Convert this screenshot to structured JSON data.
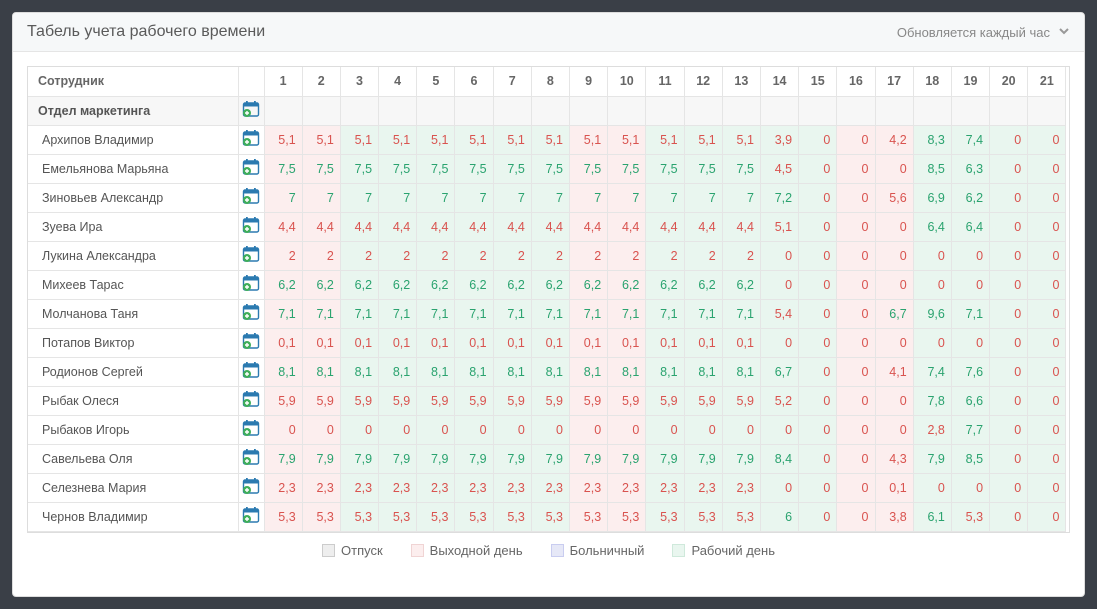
{
  "panel": {
    "title": "Табель учета рабочего времени",
    "refresh": "Обновляется каждый час"
  },
  "columns": {
    "employee": "Сотрудник"
  },
  "days": [
    1,
    2,
    3,
    4,
    5,
    6,
    7,
    8,
    9,
    10,
    11,
    12,
    13,
    14,
    15,
    16,
    17,
    18,
    19,
    20,
    21
  ],
  "day_types": [
    "w",
    "w",
    "g",
    "g",
    "g",
    "g",
    "g",
    "g",
    "w",
    "w",
    "g",
    "g",
    "g",
    "g",
    "g",
    "w",
    "w",
    "g",
    "g",
    "g",
    "g"
  ],
  "department": {
    "name": "Отдел маркетинга"
  },
  "employees": [
    {
      "name": "Архипов Владимир",
      "v": [
        "5,1",
        "5,1",
        "5,1",
        "5,1",
        "5,1",
        "5,1",
        "5,1",
        "5,1",
        "5,1",
        "5,1",
        "5,1",
        "5,1",
        "5,1",
        "3,9",
        "0",
        "0",
        "4,2",
        "8,3",
        "7,4",
        "0",
        "0"
      ],
      "c": [
        "r",
        "r",
        "r",
        "r",
        "r",
        "r",
        "r",
        "r",
        "r",
        "r",
        "r",
        "r",
        "r",
        "r",
        "r",
        "r",
        "r",
        "g",
        "g",
        "r",
        "r"
      ]
    },
    {
      "name": "Емельянова Марьяна",
      "v": [
        "7,5",
        "7,5",
        "7,5",
        "7,5",
        "7,5",
        "7,5",
        "7,5",
        "7,5",
        "7,5",
        "7,5",
        "7,5",
        "7,5",
        "7,5",
        "4,5",
        "0",
        "0",
        "0",
        "8,5",
        "6,3",
        "0",
        "0"
      ],
      "c": [
        "g",
        "g",
        "g",
        "g",
        "g",
        "g",
        "g",
        "g",
        "g",
        "g",
        "g",
        "g",
        "g",
        "r",
        "r",
        "r",
        "r",
        "g",
        "g",
        "r",
        "r"
      ]
    },
    {
      "name": "Зиновьев Александр",
      "v": [
        "7",
        "7",
        "7",
        "7",
        "7",
        "7",
        "7",
        "7",
        "7",
        "7",
        "7",
        "7",
        "7",
        "7,2",
        "0",
        "0",
        "5,6",
        "6,9",
        "6,2",
        "0",
        "0"
      ],
      "c": [
        "g",
        "g",
        "g",
        "g",
        "g",
        "g",
        "g",
        "g",
        "g",
        "g",
        "g",
        "g",
        "g",
        "g",
        "r",
        "r",
        "r",
        "g",
        "g",
        "r",
        "r"
      ]
    },
    {
      "name": "Зуева Ира",
      "v": [
        "4,4",
        "4,4",
        "4,4",
        "4,4",
        "4,4",
        "4,4",
        "4,4",
        "4,4",
        "4,4",
        "4,4",
        "4,4",
        "4,4",
        "4,4",
        "5,1",
        "0",
        "0",
        "0",
        "6,4",
        "6,4",
        "0",
        "0"
      ],
      "c": [
        "r",
        "r",
        "r",
        "r",
        "r",
        "r",
        "r",
        "r",
        "r",
        "r",
        "r",
        "r",
        "r",
        "r",
        "r",
        "r",
        "r",
        "g",
        "g",
        "r",
        "r"
      ]
    },
    {
      "name": "Лукина Александра",
      "v": [
        "2",
        "2",
        "2",
        "2",
        "2",
        "2",
        "2",
        "2",
        "2",
        "2",
        "2",
        "2",
        "2",
        "0",
        "0",
        "0",
        "0",
        "0",
        "0",
        "0",
        "0"
      ],
      "c": [
        "r",
        "r",
        "r",
        "r",
        "r",
        "r",
        "r",
        "r",
        "r",
        "r",
        "r",
        "r",
        "r",
        "r",
        "r",
        "r",
        "r",
        "r",
        "r",
        "r",
        "r"
      ]
    },
    {
      "name": "Михеев Тарас",
      "v": [
        "6,2",
        "6,2",
        "6,2",
        "6,2",
        "6,2",
        "6,2",
        "6,2",
        "6,2",
        "6,2",
        "6,2",
        "6,2",
        "6,2",
        "6,2",
        "0",
        "0",
        "0",
        "0",
        "0",
        "0",
        "0",
        "0"
      ],
      "c": [
        "g",
        "g",
        "g",
        "g",
        "g",
        "g",
        "g",
        "g",
        "g",
        "g",
        "g",
        "g",
        "g",
        "r",
        "r",
        "r",
        "r",
        "r",
        "r",
        "r",
        "r"
      ]
    },
    {
      "name": "Молчанова Таня",
      "v": [
        "7,1",
        "7,1",
        "7,1",
        "7,1",
        "7,1",
        "7,1",
        "7,1",
        "7,1",
        "7,1",
        "7,1",
        "7,1",
        "7,1",
        "7,1",
        "5,4",
        "0",
        "0",
        "6,7",
        "9,6",
        "7,1",
        "0",
        "0"
      ],
      "c": [
        "g",
        "g",
        "g",
        "g",
        "g",
        "g",
        "g",
        "g",
        "g",
        "g",
        "g",
        "g",
        "g",
        "r",
        "r",
        "r",
        "g",
        "g",
        "g",
        "r",
        "r"
      ]
    },
    {
      "name": "Потапов Виктор",
      "v": [
        "0,1",
        "0,1",
        "0,1",
        "0,1",
        "0,1",
        "0,1",
        "0,1",
        "0,1",
        "0,1",
        "0,1",
        "0,1",
        "0,1",
        "0,1",
        "0",
        "0",
        "0",
        "0",
        "0",
        "0",
        "0",
        "0"
      ],
      "c": [
        "r",
        "r",
        "r",
        "r",
        "r",
        "r",
        "r",
        "r",
        "r",
        "r",
        "r",
        "r",
        "r",
        "r",
        "r",
        "r",
        "r",
        "r",
        "r",
        "r",
        "r"
      ]
    },
    {
      "name": "Родионов Сергей",
      "v": [
        "8,1",
        "8,1",
        "8,1",
        "8,1",
        "8,1",
        "8,1",
        "8,1",
        "8,1",
        "8,1",
        "8,1",
        "8,1",
        "8,1",
        "8,1",
        "6,7",
        "0",
        "0",
        "4,1",
        "7,4",
        "7,6",
        "0",
        "0"
      ],
      "c": [
        "g",
        "g",
        "g",
        "g",
        "g",
        "g",
        "g",
        "g",
        "g",
        "g",
        "g",
        "g",
        "g",
        "g",
        "r",
        "r",
        "r",
        "g",
        "g",
        "r",
        "r"
      ]
    },
    {
      "name": "Рыбак Олеся",
      "v": [
        "5,9",
        "5,9",
        "5,9",
        "5,9",
        "5,9",
        "5,9",
        "5,9",
        "5,9",
        "5,9",
        "5,9",
        "5,9",
        "5,9",
        "5,9",
        "5,2",
        "0",
        "0",
        "0",
        "7,8",
        "6,6",
        "0",
        "0"
      ],
      "c": [
        "r",
        "r",
        "r",
        "r",
        "r",
        "r",
        "r",
        "r",
        "r",
        "r",
        "r",
        "r",
        "r",
        "r",
        "r",
        "r",
        "r",
        "g",
        "g",
        "r",
        "r"
      ]
    },
    {
      "name": "Рыбаков Игорь",
      "v": [
        "0",
        "0",
        "0",
        "0",
        "0",
        "0",
        "0",
        "0",
        "0",
        "0",
        "0",
        "0",
        "0",
        "0",
        "0",
        "0",
        "0",
        "2,8",
        "7,7",
        "0",
        "0"
      ],
      "c": [
        "r",
        "r",
        "r",
        "r",
        "r",
        "r",
        "r",
        "r",
        "r",
        "r",
        "r",
        "r",
        "r",
        "r",
        "r",
        "r",
        "r",
        "r",
        "g",
        "r",
        "r"
      ]
    },
    {
      "name": "Савельева Оля",
      "v": [
        "7,9",
        "7,9",
        "7,9",
        "7,9",
        "7,9",
        "7,9",
        "7,9",
        "7,9",
        "7,9",
        "7,9",
        "7,9",
        "7,9",
        "7,9",
        "8,4",
        "0",
        "0",
        "4,3",
        "7,9",
        "8,5",
        "0",
        "0"
      ],
      "c": [
        "g",
        "g",
        "g",
        "g",
        "g",
        "g",
        "g",
        "g",
        "g",
        "g",
        "g",
        "g",
        "g",
        "g",
        "r",
        "r",
        "r",
        "g",
        "g",
        "r",
        "r"
      ]
    },
    {
      "name": "Селезнева Мария",
      "v": [
        "2,3",
        "2,3",
        "2,3",
        "2,3",
        "2,3",
        "2,3",
        "2,3",
        "2,3",
        "2,3",
        "2,3",
        "2,3",
        "2,3",
        "2,3",
        "0",
        "0",
        "0",
        "0,1",
        "0",
        "0",
        "0",
        "0"
      ],
      "c": [
        "r",
        "r",
        "r",
        "r",
        "r",
        "r",
        "r",
        "r",
        "r",
        "r",
        "r",
        "r",
        "r",
        "r",
        "r",
        "r",
        "r",
        "r",
        "r",
        "r",
        "r"
      ]
    },
    {
      "name": "Чернов Владимир",
      "v": [
        "5,3",
        "5,3",
        "5,3",
        "5,3",
        "5,3",
        "5,3",
        "5,3",
        "5,3",
        "5,3",
        "5,3",
        "5,3",
        "5,3",
        "5,3",
        "6",
        "0",
        "0",
        "3,8",
        "6,1",
        "5,3",
        "0",
        "0"
      ],
      "c": [
        "r",
        "r",
        "r",
        "r",
        "r",
        "r",
        "r",
        "r",
        "r",
        "r",
        "r",
        "r",
        "r",
        "g",
        "r",
        "r",
        "r",
        "g",
        "r",
        "r",
        "r"
      ]
    }
  ],
  "legend": {
    "vacation": "Отпуск",
    "dayoff": "Выходной день",
    "sick": "Больничный",
    "workday": "Рабочий день"
  }
}
